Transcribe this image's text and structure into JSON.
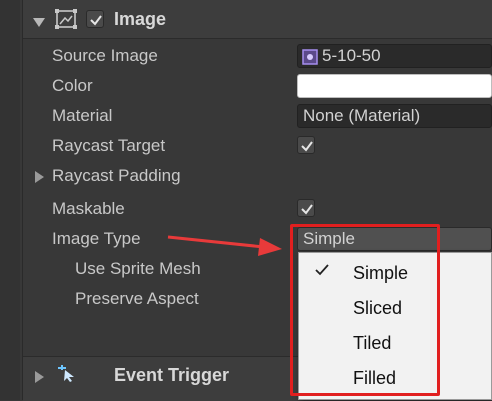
{
  "component": {
    "title": "Image",
    "enabled": true
  },
  "properties": {
    "source_image": {
      "label": "Source Image",
      "value": "5-10-50"
    },
    "color": {
      "label": "Color",
      "value": "#ffffff"
    },
    "material": {
      "label": "Material",
      "value": "None (Material)"
    },
    "raycast_target": {
      "label": "Raycast Target",
      "checked": true
    },
    "raycast_padding": {
      "label": "Raycast Padding",
      "expanded": false
    },
    "maskable": {
      "label": "Maskable",
      "checked": true
    },
    "image_type": {
      "label": "Image Type",
      "value": "Simple"
    },
    "use_sprite_mesh": {
      "label": "Use Sprite Mesh"
    },
    "preserve_aspect": {
      "label": "Preserve Aspect"
    }
  },
  "dropdown_menu": {
    "options": [
      {
        "label": "Simple",
        "selected": true
      },
      {
        "label": "Sliced",
        "selected": false
      },
      {
        "label": "Tiled",
        "selected": false
      },
      {
        "label": "Filled",
        "selected": false
      }
    ]
  },
  "next_component": {
    "title": "Event Trigger"
  },
  "annotation": {
    "arrow_color": "#e83a3a",
    "box_color": "#e11f1f"
  }
}
